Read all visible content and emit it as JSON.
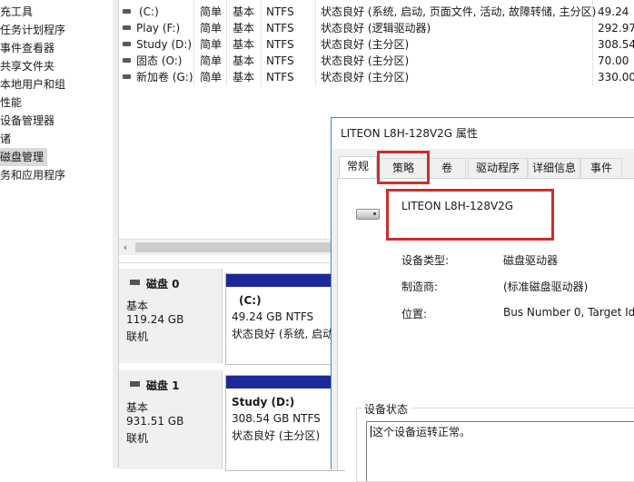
{
  "nav": {
    "items": [
      {
        "label": "充工具",
        "selected": false
      },
      {
        "label": "任务计划程序",
        "selected": false
      },
      {
        "label": "事件查看器",
        "selected": false
      },
      {
        "label": "共享文件夹",
        "selected": false
      },
      {
        "label": "本地用户和组",
        "selected": false
      },
      {
        "label": "性能",
        "selected": false
      },
      {
        "label": "设备管理器",
        "selected": false
      },
      {
        "label": "诸",
        "selected": false
      },
      {
        "label": "磁盘管理",
        "selected": true
      },
      {
        "label": "务和应用程序",
        "selected": false
      }
    ]
  },
  "volumes": {
    "rows": [
      {
        "name": "(C:)",
        "layout": "简单",
        "type": "基本",
        "fs": "NTFS",
        "status": "状态良好 (系统, 启动, 页面文件, 活动, 故障转储, 主分区)",
        "capacity": "49.24"
      },
      {
        "name": "Play (F:)",
        "layout": "简单",
        "type": "基本",
        "fs": "NTFS",
        "status": "状态良好 (逻辑驱动器)",
        "capacity": "292.97"
      },
      {
        "name": "Study (D:)",
        "layout": "简单",
        "type": "基本",
        "fs": "NTFS",
        "status": "状态良好 (主分区)",
        "capacity": "308.54"
      },
      {
        "name": "固态 (O:)",
        "layout": "简单",
        "type": "基本",
        "fs": "NTFS",
        "status": "状态良好 (主分区)",
        "capacity": "70.00"
      },
      {
        "name": "新加卷 (G:)",
        "layout": "简单",
        "type": "基本",
        "fs": "NTFS",
        "status": "状态良好 (主分区)",
        "capacity": "330.00"
      }
    ],
    "scroll_left_icon": "‹"
  },
  "disks": [
    {
      "name": "磁盘 0",
      "type": "基本",
      "size": "119.24 GB",
      "state": "联机",
      "partition": {
        "label": "(C:)",
        "size_fs": "49.24 GB NTFS",
        "status": "状态良好 (系统, 启动"
      }
    },
    {
      "name": "磁盘 1",
      "type": "基本",
      "size": "931.51 GB",
      "state": "联机",
      "partition": {
        "label": "Study  (D:)",
        "size_fs": "308.54 GB NTFS",
        "status": "状态良好 (主分区)"
      }
    }
  ],
  "dialog": {
    "title": "LITEON L8H-128V2G 属性",
    "tabs": [
      "常规",
      "策略",
      "卷",
      "驱动程序",
      "详细信息",
      "事件"
    ],
    "active_tab": "常规",
    "device_name": "LITEON L8H-128V2G",
    "props": [
      {
        "label": "设备类型:",
        "value": "磁盘驱动器"
      },
      {
        "label": "制造商:",
        "value": "(标准磁盘驱动器)"
      },
      {
        "label": "位置:",
        "value": "Bus Number 0, Target Id"
      }
    ],
    "status_group_label": "设备状态",
    "status_text": "这个设备运转正常。"
  },
  "colors": {
    "highlight": "#d22b2b",
    "partition_bar": "#1c2a98",
    "dialog_border": "#3c8ec9"
  }
}
